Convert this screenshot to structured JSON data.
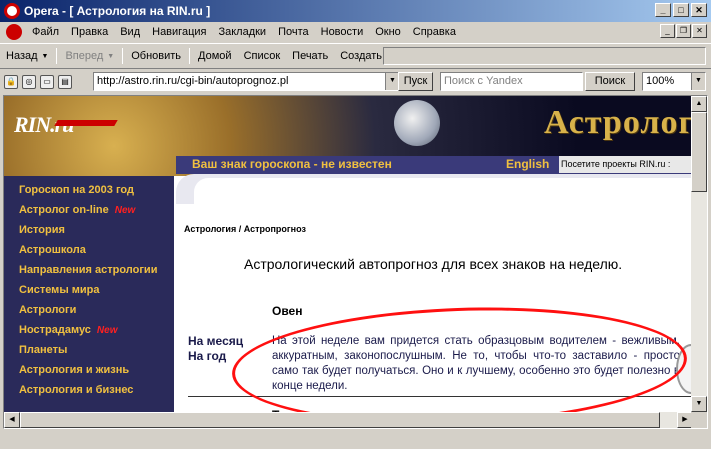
{
  "window": {
    "title": "Opera - [ Астрология на RIN.ru ]"
  },
  "menu": {
    "items": [
      "Файл",
      "Правка",
      "Вид",
      "Навигация",
      "Закладки",
      "Почта",
      "Новости",
      "Окно",
      "Справка"
    ]
  },
  "nav": {
    "back": "Назад",
    "forward": "Вперед",
    "reload": "Обновить",
    "home": "Домой",
    "list": "Список",
    "print": "Печать",
    "create": "Создать"
  },
  "address": {
    "url": "http://astro.rin.ru/cgi-bin/autoprognoz.pl",
    "go": "Пуск",
    "search_placeholder": "Поиск с Yandex",
    "search_button": "Поиск",
    "zoom": "100%"
  },
  "site": {
    "logo": "RIN.ru",
    "banner_word": "Астролог",
    "sign_status": "Ваш знак гороскопа - не известен",
    "english_link": "English",
    "visit_projects": "Посетите проекты RIN.ru :"
  },
  "sidebar": {
    "items": [
      {
        "label": "Гороскоп на 2003 год",
        "new": ""
      },
      {
        "label": "Астролог on-line",
        "new": "New"
      },
      {
        "label": "История",
        "new": ""
      },
      {
        "label": "Астрошкола",
        "new": ""
      },
      {
        "label": "Направления астрологии",
        "new": ""
      },
      {
        "label": "Системы мира",
        "new": ""
      },
      {
        "label": "Астрологи",
        "new": ""
      },
      {
        "label": "Нострадамус",
        "new": "New"
      },
      {
        "label": "Планеты",
        "new": ""
      },
      {
        "label": "Астрология и жизнь",
        "new": ""
      },
      {
        "label": "Астрология и бизнес",
        "new": ""
      }
    ]
  },
  "content": {
    "breadcrumb": "Астрология / Астропрогноз",
    "headline": "Астрологический автопрогноз для всех знаков на неделю.",
    "sign1": "Овен",
    "period_week": "На месяц",
    "period_year": "На год",
    "forecast": "На этой неделе вам придется стать образцовым водителем - вежливым, аккуратным, законопослушным. Не то, чтобы что-то заставило - просто само так будет получаться. Оно и к лучшему, особенно это будет полезно в конце недели.",
    "sign2": "Телец"
  },
  "colors": {
    "title_bar": "#0a246a",
    "sidebar_bg": "#2a2a5a",
    "gold": "#f0c040",
    "annotation_red": "#ff1010"
  }
}
